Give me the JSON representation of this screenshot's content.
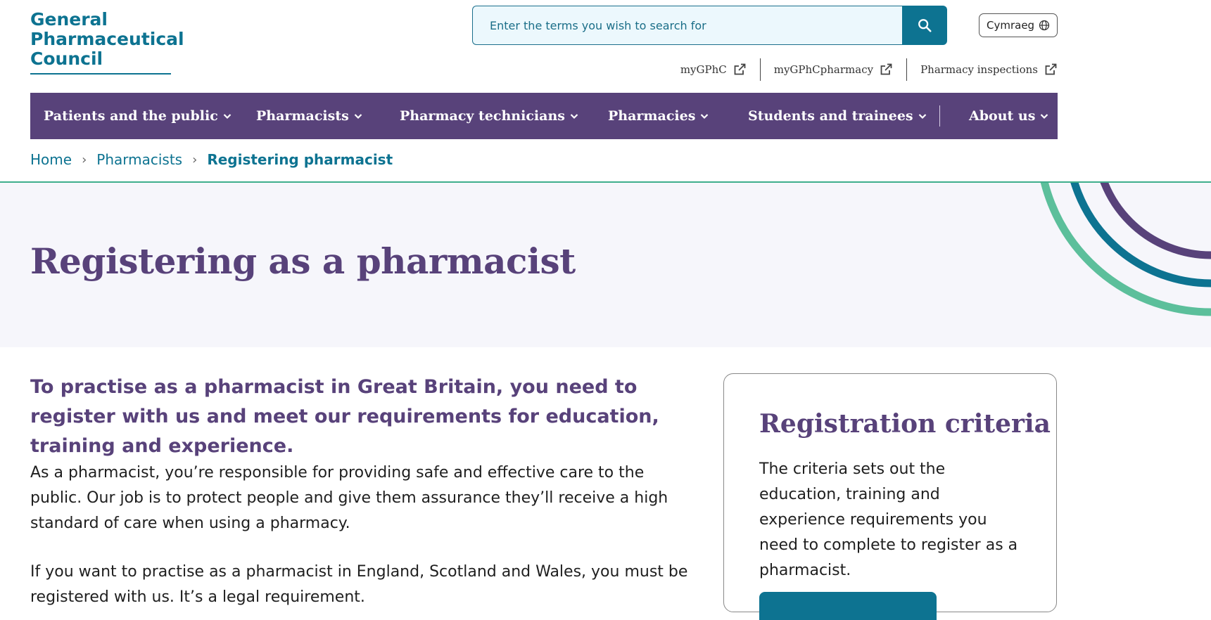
{
  "header": {
    "logo_lines": [
      "General",
      "Pharmaceutical",
      "Council"
    ],
    "search_placeholder": "Enter the terms you wish to search for",
    "language_label": "Cymraeg",
    "utility_links": [
      "myGPhC",
      "myGPhCpharmacy",
      "Pharmacy inspections"
    ]
  },
  "nav": {
    "items": [
      "Patients and the public",
      "Pharmacists",
      "Pharmacy technicians",
      "Pharmacies",
      "Students and trainees",
      "About us"
    ]
  },
  "breadcrumb": {
    "home": "Home",
    "parent": "Pharmacists",
    "current": "Registering pharmacist"
  },
  "hero": {
    "title": "Registering as a pharmacist"
  },
  "content": {
    "intro": "To practise as a pharmacist in Great Britain, you need to register with us and meet our requirements for education, training and experience.",
    "paragraph1": "As a pharmacist, you’re responsible for providing safe and effective care to the public. Our job is to protect people and give them assurance they’ll receive a high standard of care when using a pharmacy.",
    "paragraph2": "If you want to practise as a pharmacist in England, Scotland and Wales, you must be registered with us. It’s a legal requirement."
  },
  "card": {
    "title": "Registration criteria",
    "text": "The criteria sets out the education, training and experience requirements you need to complete to register as a pharmacist."
  },
  "colors": {
    "brand_teal": "#0d7391",
    "brand_purple": "#58427a",
    "accent_green": "#5cbf9b",
    "hero_bg": "#f6f6fb"
  }
}
